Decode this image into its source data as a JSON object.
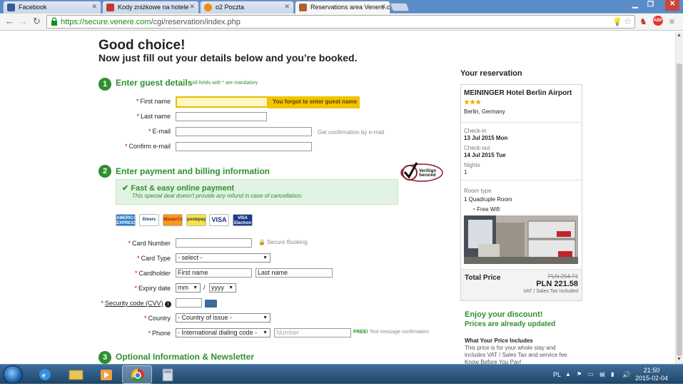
{
  "browser": {
    "tabs": [
      {
        "label": "Facebook",
        "favicon_color": "#3b5998"
      },
      {
        "label": "Kody zniżkowe na hotele",
        "favicon_color": "#c0392b"
      },
      {
        "label": "o2 Poczta",
        "favicon_color": "#f08c00"
      },
      {
        "label": "Reservations area Venere.c",
        "favicon_color": "#b0622b"
      }
    ],
    "url_host": "https://secure.venere.com",
    "url_path": "/cgi/reservation/index.php"
  },
  "page": {
    "heading": "Good choice!",
    "subheading": "Now just fill out your details below and you’re booked.",
    "step1": {
      "number": "1",
      "title": "Enter guest details",
      "note": "All fields with * are mandatory"
    },
    "guest": {
      "first_name_label": "First name",
      "last_name_label": "Last name",
      "email_label": "E-mail",
      "confirm_email_label": "Confirm e-mail",
      "error": "You forgot to enter guest name",
      "email_hint": "Get confirmation by e-mail"
    },
    "step2": {
      "number": "2",
      "title": "Enter payment and billing information"
    },
    "payment_box": {
      "title": "Fast & easy online payment",
      "note": "This special deal doesn't provide any refund in case of cancellation."
    },
    "cards": [
      "AMERICAN EXPRESS",
      "Diners Club",
      "MasterCard",
      "postepay",
      "VISA",
      "VISA Electron"
    ],
    "verisign": "VeriSign Secured",
    "payment": {
      "card_number_label": "Card Number",
      "secure_booking": "Secure Booking",
      "card_type_label": "Card Type",
      "card_type_value": "- select -",
      "cardholder_label": "Cardholder",
      "first_name_placeholder": "First name",
      "last_name_placeholder": "Last name",
      "expiry_label": "Expiry date",
      "month_value": "mm",
      "separator": "/",
      "year_value": "yyyy",
      "cvv_label": "Security code (CVV)",
      "country_label": "Country",
      "country_value": "- Country of issue -",
      "phone_label": "Phone",
      "dialing_value": "- International dialing code -",
      "number_placeholder": "Number",
      "free_label": "FREE!",
      "free_text": "Text message confirmation"
    },
    "step3": {
      "number": "3",
      "title": "Optional Information & Newsletter"
    }
  },
  "reservation": {
    "title": "Your reservation",
    "hotel": "MEININGER Hotel Berlin Airport",
    "stars": "★★★",
    "location": "Berlin, Germany",
    "checkin_label": "Check-in",
    "checkin_value": "13 Jul 2015 Mon",
    "checkout_label": "Check-out",
    "checkout_value": "14 Jul 2015 Tue",
    "nights_label": "Nights",
    "nights_value": "1",
    "room_type_label": "Room type",
    "room_value": "1  Quadruple Room",
    "wifi": "Free Wifi",
    "total_label": "Total Price",
    "old_price": "PLN 254.71",
    "price": "PLN 221.58",
    "vat_note": "VAT / Sales Tax Included",
    "enjoy": "Enjoy your discount!",
    "prices_updated": "Prices are already updated",
    "what_label": "What Your Price Includes",
    "what_text": "This price is for your whole stay and includes VAT / Sales Tax and service fee. Know Before You Pay!"
  },
  "taskbar": {
    "lang": "PL",
    "time": "21:50",
    "date": "2015-02-04"
  }
}
